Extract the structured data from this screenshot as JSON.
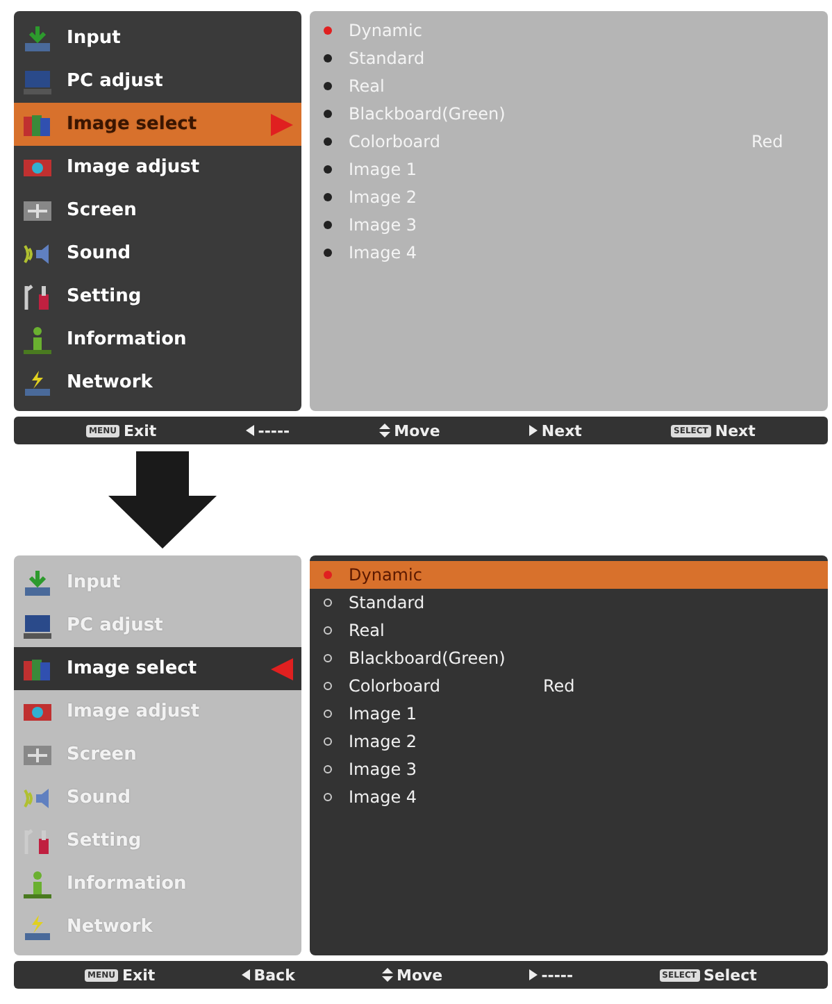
{
  "screens": [
    {
      "kind": "menu",
      "menu": [
        {
          "kind": "input",
          "label": "Input",
          "selected": false
        },
        {
          "kind": "pc",
          "label": "PC adjust",
          "selected": false
        },
        {
          "kind": "image-select",
          "label": "Image select",
          "selected": true
        },
        {
          "kind": "image-adjust",
          "label": "Image adjust",
          "selected": false
        },
        {
          "kind": "screen",
          "label": "Screen",
          "selected": false
        },
        {
          "kind": "sound",
          "label": "Sound",
          "selected": false
        },
        {
          "kind": "setting",
          "label": "Setting",
          "selected": false
        },
        {
          "kind": "information",
          "label": "Information",
          "selected": false
        },
        {
          "kind": "network",
          "label": "Network",
          "selected": false
        }
      ],
      "submenu": [
        {
          "label": "Dynamic",
          "checked": true,
          "highlighted": false
        },
        {
          "label": "Standard",
          "checked": false,
          "highlighted": false
        },
        {
          "label": "Real",
          "checked": false,
          "highlighted": false
        },
        {
          "label": "Blackboard(Green)",
          "checked": false,
          "highlighted": false
        },
        {
          "label": "Colorboard",
          "value": "Red",
          "checked": false,
          "highlighted": false
        },
        {
          "label": "Image 1",
          "checked": false,
          "highlighted": false
        },
        {
          "label": "Image 2",
          "checked": false,
          "highlighted": false
        },
        {
          "label": "Image 3",
          "checked": false,
          "highlighted": false
        },
        {
          "label": "Image 4",
          "checked": false,
          "highlighted": false
        }
      ],
      "footer": [
        {
          "kind": "key",
          "key": "MENU",
          "label": "Exit"
        },
        {
          "kind": "left",
          "label": "-----"
        },
        {
          "kind": "updown",
          "label": "Move"
        },
        {
          "kind": "right",
          "label": "Next"
        },
        {
          "kind": "key",
          "key": "SELECT",
          "label": "Next"
        }
      ]
    },
    {
      "kind": "submenu",
      "menu": [
        {
          "kind": "input",
          "label": "Input",
          "selected": false
        },
        {
          "kind": "pc",
          "label": "PC adjust",
          "selected": false
        },
        {
          "kind": "image-select",
          "label": "Image select",
          "selected": true
        },
        {
          "kind": "image-adjust",
          "label": "Image adjust",
          "selected": false
        },
        {
          "kind": "screen",
          "label": "Screen",
          "selected": false
        },
        {
          "kind": "sound",
          "label": "Sound",
          "selected": false
        },
        {
          "kind": "setting",
          "label": "Setting",
          "selected": false
        },
        {
          "kind": "information",
          "label": "Information",
          "selected": false
        },
        {
          "kind": "network",
          "label": "Network",
          "selected": false
        }
      ],
      "submenu": [
        {
          "label": "Dynamic",
          "checked": true,
          "highlighted": true
        },
        {
          "label": "Standard",
          "checked": false,
          "highlighted": false
        },
        {
          "label": "Real",
          "checked": false,
          "highlighted": false
        },
        {
          "label": "Blackboard(Green)",
          "checked": false,
          "highlighted": false
        },
        {
          "label": "Colorboard",
          "value": "Red",
          "checked": false,
          "highlighted": false
        },
        {
          "label": "Image 1",
          "checked": false,
          "highlighted": false
        },
        {
          "label": "Image 2",
          "checked": false,
          "highlighted": false
        },
        {
          "label": "Image 3",
          "checked": false,
          "highlighted": false
        },
        {
          "label": "Image 4",
          "checked": false,
          "highlighted": false
        }
      ],
      "footer": [
        {
          "kind": "key",
          "key": "MENU",
          "label": "Exit"
        },
        {
          "kind": "left",
          "label": "Back"
        },
        {
          "kind": "updown",
          "label": "Move"
        },
        {
          "kind": "right",
          "label": "-----"
        },
        {
          "kind": "key",
          "key": "SELECT",
          "label": "Select"
        }
      ]
    }
  ]
}
